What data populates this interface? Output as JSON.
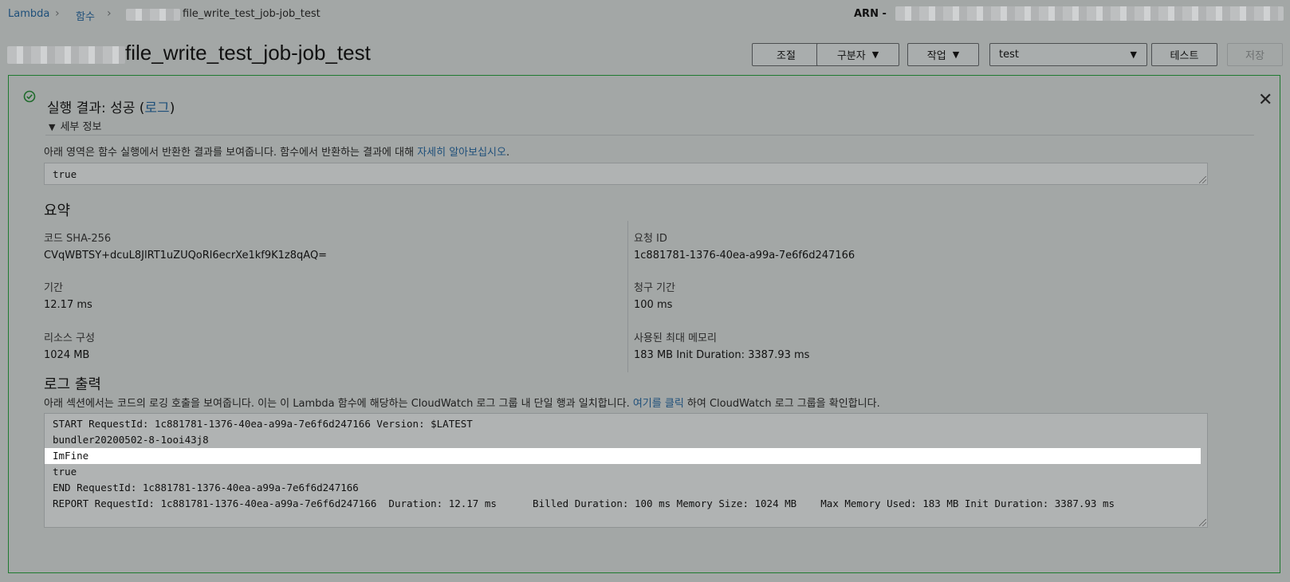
{
  "breadcrumb": {
    "root": "Lambda",
    "functions": "함수",
    "current_suffix": "file_write_test_job-job_test"
  },
  "arn": {
    "label": "ARN -"
  },
  "page": {
    "title_suffix": "file_write_test_job-job_test"
  },
  "toolbar": {
    "throttle": "조절",
    "qualifiers": "구분자",
    "actions": "작업",
    "test_event": "test",
    "test": "테스트",
    "save": "저장"
  },
  "result": {
    "title_prefix": "실행 결과: 성공 (",
    "log_link": "로그",
    "title_suffix": ")",
    "details_toggle": "세부 정보",
    "return_desc_prefix": "아래 영역은 함수 실행에서 반환한 결과를 보여줍니다. 함수에서 반환하는 결과에 대해 ",
    "return_desc_link": "자세히 알아보십시오",
    "return_desc_suffix": ".",
    "return_value": "true"
  },
  "summary": {
    "title": "요약",
    "code_sha_label": "코드 SHA-256",
    "code_sha_value": "CVqWBTSY+dcuL8JlRT1uZUQoRl6ecrXe1kf9K1z8qAQ=",
    "request_id_label": "요청 ID",
    "request_id_value": "1c881781-1376-40ea-a99a-7e6f6d247166",
    "duration_label": "기간",
    "duration_value": "12.17 ms",
    "billed_label": "청구 기간",
    "billed_value": "100 ms",
    "resources_label": "리소스 구성",
    "resources_value": "1024 MB",
    "max_memory_label": "사용된 최대 메모리",
    "max_memory_value": "183 MB Init Duration: 3387.93 ms"
  },
  "log": {
    "title": "로그 출력",
    "desc_prefix": "아래 섹션에서는 코드의 로깅 호출을 보여줍니다. 이는 이 Lambda 함수에 해당하는 CloudWatch 로그 그룹 내 단일 행과 일치합니다. ",
    "desc_link": "여기를 클릭",
    "desc_suffix": " 하여 CloudWatch 로그 그룹을 확인합니다.",
    "lines": [
      "START RequestId: 1c881781-1376-40ea-a99a-7e6f6d247166 Version: $LATEST",
      "bundler20200502-8-1ooi43j8",
      "ImFine",
      "true",
      "END RequestId: 1c881781-1376-40ea-a99a-7e6f6d247166",
      "REPORT RequestId: 1c881781-1376-40ea-a99a-7e6f6d247166  Duration: 12.17 ms      Billed Duration: 100 ms Memory Size: 1024 MB    Max Memory Used: 183 MB Init Duration: 3387.93 ms"
    ]
  },
  "colors": {
    "link": "#1e4f7a",
    "success_border": "#1f7a30",
    "highlight": "#ffffff"
  }
}
